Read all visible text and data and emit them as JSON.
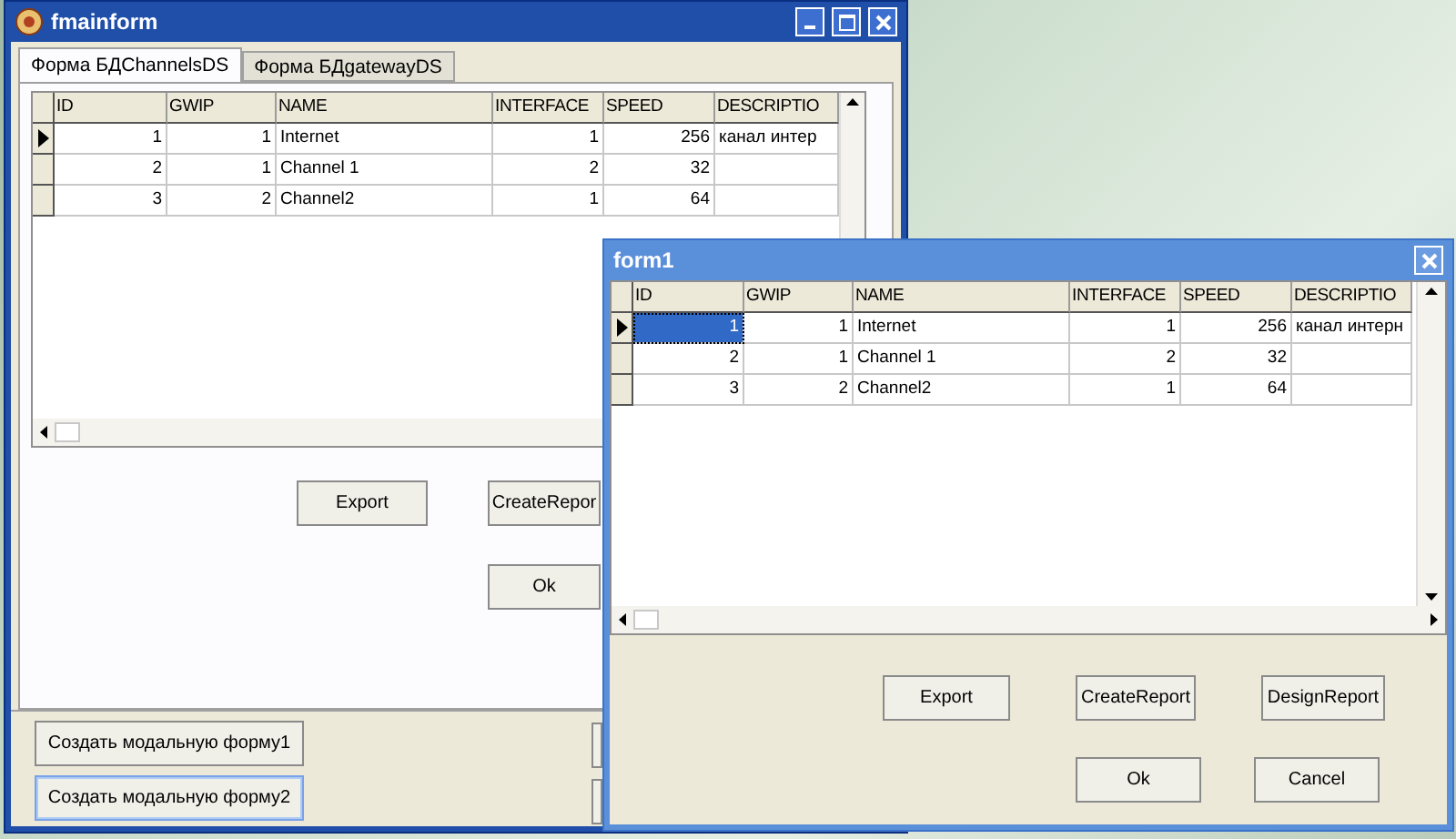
{
  "main_window": {
    "title": "fmainform",
    "tabs": [
      {
        "label": "Форма БДChannelsDS",
        "selected": true
      },
      {
        "label": "Форма БДgatewayDS",
        "selected": false
      }
    ],
    "grid": {
      "cell_highlight": false,
      "columns": [
        "ID",
        "GWIP",
        "NAME",
        "INTERFACE",
        "SPEED",
        "DESCRIPTIO"
      ],
      "rows": [
        {
          "selected": true,
          "cells": [
            "1",
            "1",
            "Internet",
            "1",
            "256",
            "канал интер"
          ]
        },
        {
          "selected": false,
          "cells": [
            "2",
            "1",
            "Channel 1",
            "2",
            "32",
            ""
          ]
        },
        {
          "selected": false,
          "cells": [
            "3",
            "2",
            "Channel2",
            "1",
            "64",
            ""
          ]
        }
      ]
    },
    "buttons": [
      "Export",
      "CreateRepor",
      "Ok"
    ],
    "modal_buttons": [
      {
        "label": "Создать модальную форму1",
        "focused": false
      },
      {
        "label": "Создать модальную форму2",
        "focused": true
      }
    ]
  },
  "form1": {
    "title": "form1",
    "grid": {
      "cell_highlight": true,
      "columns": [
        "ID",
        "GWIP",
        "NAME",
        "INTERFACE",
        "SPEED",
        "DESCRIPTIO"
      ],
      "rows": [
        {
          "selected": true,
          "cells": [
            "1",
            "1",
            "Internet",
            "1",
            "256",
            "канал интерн"
          ]
        },
        {
          "selected": false,
          "cells": [
            "2",
            "1",
            "Channel 1",
            "2",
            "32",
            ""
          ]
        },
        {
          "selected": false,
          "cells": [
            "3",
            "2",
            "Channel2",
            "1",
            "64",
            ""
          ]
        }
      ]
    },
    "buttons": [
      "Export",
      "CreateReport",
      "DesignReport"
    ],
    "bottom_buttons": [
      "Ok",
      "Cancel"
    ]
  }
}
